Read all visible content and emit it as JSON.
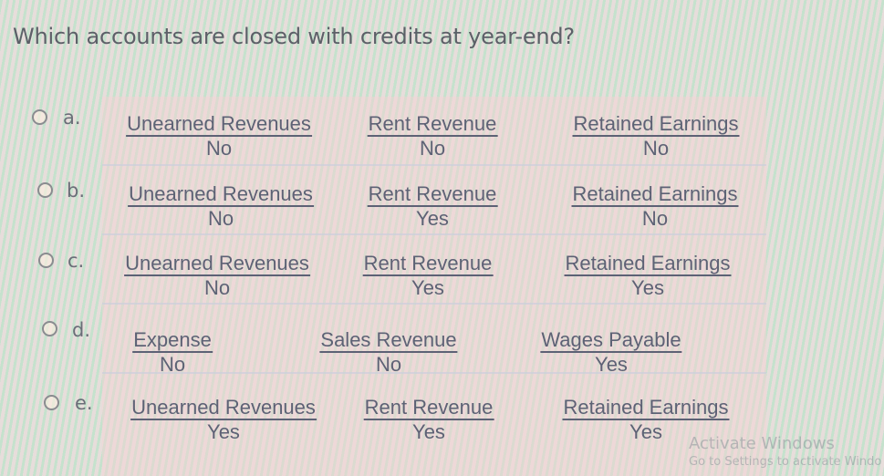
{
  "question": "Which accounts are closed with credits at year-end?",
  "options": [
    {
      "letter": "a.",
      "accounts": [
        {
          "name": "Unearned Revenues",
          "value": "No"
        },
        {
          "name": "Rent Revenue",
          "value": "No"
        },
        {
          "name": "Retained Earnings",
          "value": "No"
        }
      ]
    },
    {
      "letter": "b.",
      "accounts": [
        {
          "name": "Unearned Revenues",
          "value": "No"
        },
        {
          "name": "Rent Revenue",
          "value": "Yes"
        },
        {
          "name": "Retained Earnings",
          "value": "No"
        }
      ]
    },
    {
      "letter": "c.",
      "accounts": [
        {
          "name": "Unearned Revenues",
          "value": "No"
        },
        {
          "name": "Rent Revenue",
          "value": "Yes"
        },
        {
          "name": "Retained Earnings",
          "value": "Yes"
        }
      ]
    },
    {
      "letter": "d.",
      "accounts": [
        {
          "name": "Expense",
          "value": "No"
        },
        {
          "name": "Sales Revenue",
          "value": "No"
        },
        {
          "name": "Wages Payable",
          "value": "Yes"
        }
      ]
    },
    {
      "letter": "e.",
      "accounts": [
        {
          "name": "Unearned Revenues",
          "value": "Yes"
        },
        {
          "name": "Rent Revenue",
          "value": "Yes"
        },
        {
          "name": "Retained Earnings",
          "value": "Yes"
        }
      ]
    }
  ],
  "watermark": {
    "title": "Activate Windows",
    "subtitle": "Go to Settings to activate Windo"
  }
}
